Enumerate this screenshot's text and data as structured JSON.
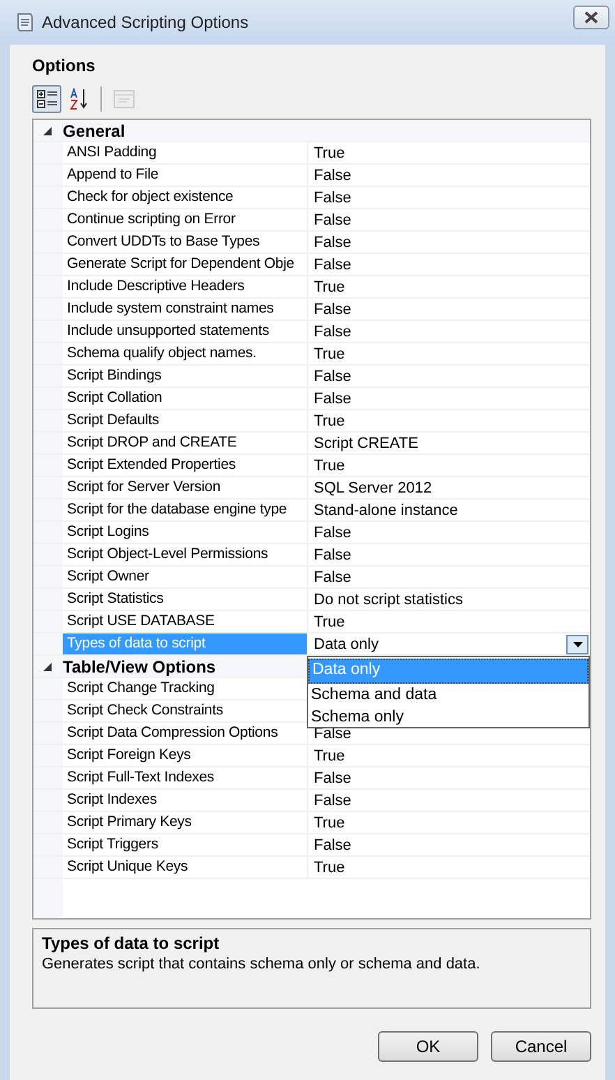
{
  "window": {
    "title": "Advanced Scripting Options"
  },
  "section_title": "Options",
  "toolbar": [
    {
      "kind": "categorized",
      "selected": true,
      "disabled": false
    },
    {
      "kind": "alphabetical",
      "selected": false,
      "disabled": false
    },
    {
      "kind": "pages",
      "selected": false,
      "disabled": true
    }
  ],
  "categories": [
    {
      "name": "General",
      "expanded": true,
      "properties": [
        {
          "name": "ANSI Padding",
          "value": "True",
          "selected": false
        },
        {
          "name": "Append to File",
          "value": "False",
          "selected": false
        },
        {
          "name": "Check for object existence",
          "value": "False",
          "selected": false
        },
        {
          "name": "Continue scripting on Error",
          "value": "False",
          "selected": false
        },
        {
          "name": "Convert UDDTs to Base Types",
          "value": "False",
          "selected": false
        },
        {
          "name": "Generate Script for Dependent Obje",
          "value": "False",
          "selected": false
        },
        {
          "name": "Include Descriptive Headers",
          "value": "True",
          "selected": false
        },
        {
          "name": "Include system constraint names",
          "value": "False",
          "selected": false
        },
        {
          "name": "Include unsupported statements",
          "value": "False",
          "selected": false
        },
        {
          "name": "Schema qualify object names.",
          "value": "True",
          "selected": false
        },
        {
          "name": "Script Bindings",
          "value": "False",
          "selected": false
        },
        {
          "name": "Script Collation",
          "value": "False",
          "selected": false
        },
        {
          "name": "Script Defaults",
          "value": "True",
          "selected": false
        },
        {
          "name": "Script DROP and CREATE",
          "value": "Script CREATE",
          "selected": false
        },
        {
          "name": "Script Extended Properties",
          "value": "True",
          "selected": false
        },
        {
          "name": "Script for Server Version",
          "value": "SQL Server 2012",
          "selected": false
        },
        {
          "name": "Script for the database engine type",
          "value": "Stand-alone instance",
          "selected": false
        },
        {
          "name": "Script Logins",
          "value": "False",
          "selected": false
        },
        {
          "name": "Script Object-Level Permissions",
          "value": "False",
          "selected": false
        },
        {
          "name": "Script Owner",
          "value": "False",
          "selected": false
        },
        {
          "name": "Script Statistics",
          "value": "Do not script statistics",
          "selected": false
        },
        {
          "name": "Script USE DATABASE",
          "value": "True",
          "selected": false
        },
        {
          "name": "Types of data to script",
          "value": "Data only",
          "selected": true,
          "dropdown": [
            {
              "label": "Data only",
              "selected": true
            },
            {
              "label": "Schema and data",
              "selected": false
            },
            {
              "label": "Schema only",
              "selected": false
            }
          ]
        }
      ]
    },
    {
      "name": "Table/View Options",
      "expanded": true,
      "properties": [
        {
          "name": "Script Change Tracking",
          "selected": false
        },
        {
          "name": "Script Check Constraints",
          "selected": false
        },
        {
          "name": "Script Data Compression Options",
          "value": "False",
          "selected": false
        },
        {
          "name": "Script Foreign Keys",
          "value": "True",
          "selected": false
        },
        {
          "name": "Script Full-Text Indexes",
          "value": "False",
          "selected": false
        },
        {
          "name": "Script Indexes",
          "value": "False",
          "selected": false
        },
        {
          "name": "Script Primary Keys",
          "value": "True",
          "selected": false
        },
        {
          "name": "Script Triggers",
          "value": "False",
          "selected": false
        },
        {
          "name": "Script Unique Keys",
          "value": "True",
          "selected": false
        }
      ]
    }
  ],
  "description": {
    "title": "Types of data to script",
    "text": "Generates script that contains schema only or schema and data."
  },
  "buttons": [
    "OK",
    "Cancel"
  ]
}
